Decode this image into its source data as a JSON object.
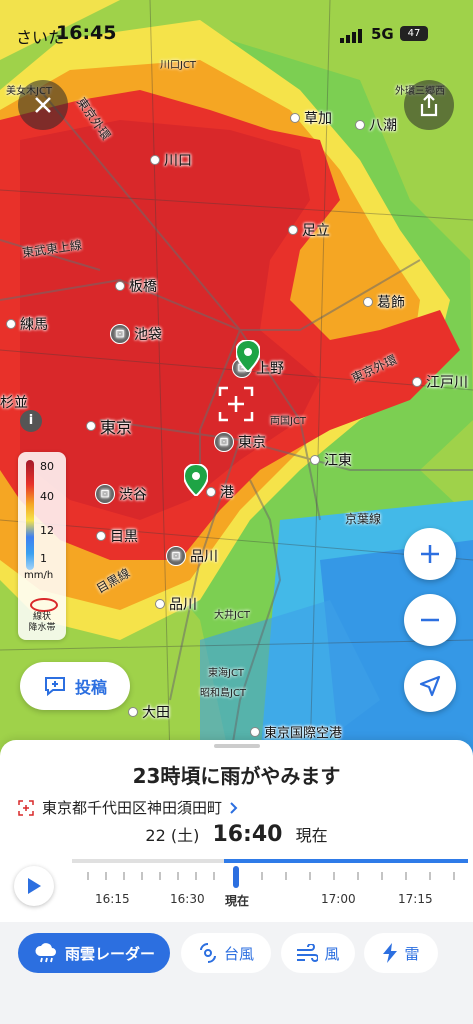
{
  "status": {
    "carrier": "さいた",
    "time": "16:45",
    "network": "5G",
    "battery": "47"
  },
  "map": {
    "places": [
      "川口",
      "草加",
      "八潮",
      "足立",
      "葛飾",
      "板橋",
      "練馬",
      "池袋",
      "上野",
      "江戸川",
      "東京",
      "東京",
      "江東",
      "渋谷",
      "港",
      "京葉線",
      "目黒",
      "品川",
      "品川",
      "大田",
      "東京国際空港",
      "杉並"
    ],
    "lines": [
      "東武東上線",
      "東京外環",
      "東京外環",
      "常磐線",
      "目黒線"
    ],
    "highways": [
      "美女木JCT",
      "川口JCT",
      "新倉",
      "大井JCT",
      "東海JCT",
      "昭和島JCT",
      "両国JCT",
      "外環三郷西",
      "両国JCT"
    ]
  },
  "legend": {
    "v80": "80",
    "v40": "40",
    "v12": "12",
    "v1": "1",
    "unit": "mm/h",
    "band_label1": "線状",
    "band_label2": "降水帯"
  },
  "buttons": {
    "post": "投稿"
  },
  "sheet": {
    "headline": "23時頃に雨がやみます",
    "address": "東京都千代田区神田須田町",
    "date": "22 (土)",
    "time": "16:40",
    "now": "現在"
  },
  "timeline": {
    "ticks": [
      "16:15",
      "16:30",
      "現在",
      "17:00",
      "17:15"
    ],
    "progress": 0.39
  },
  "tabs": [
    {
      "label": "雨雲レーダー",
      "icon": "rain-cloud-icon"
    },
    {
      "label": "台風",
      "icon": "typhoon-icon"
    },
    {
      "label": "風",
      "icon": "wind-icon"
    },
    {
      "label": "雷",
      "icon": "lightning-icon"
    }
  ],
  "colors": {
    "accent": "#2c6fe0",
    "heavy_rain": "#e8312a",
    "moderate_rain": "#f5a623",
    "light_rain": "#3f7ff0"
  }
}
